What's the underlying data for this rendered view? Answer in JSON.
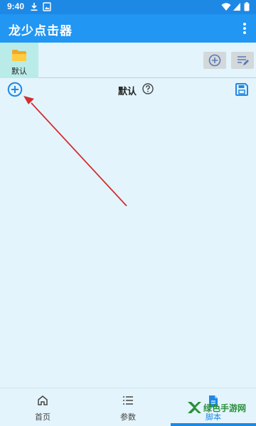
{
  "status_bar": {
    "time": "9:40"
  },
  "app_bar": {
    "title": "龙少点击器"
  },
  "folders": {
    "current": {
      "label": "默认"
    }
  },
  "script_header": {
    "title": "默认"
  },
  "bottom_nav": {
    "items": [
      {
        "label": "首页",
        "icon": "home-icon"
      },
      {
        "label": "参数",
        "icon": "list-icon"
      },
      {
        "label": "脚本",
        "icon": "document-icon",
        "active": true
      }
    ]
  },
  "watermark": {
    "text": "绿色手游网"
  },
  "colors": {
    "primary": "#2196f3",
    "status_bar": "#1e88e5",
    "background": "#e3f4fc",
    "folder_selected": "#b9ece9",
    "annotation_arrow": "#d32f2f"
  }
}
